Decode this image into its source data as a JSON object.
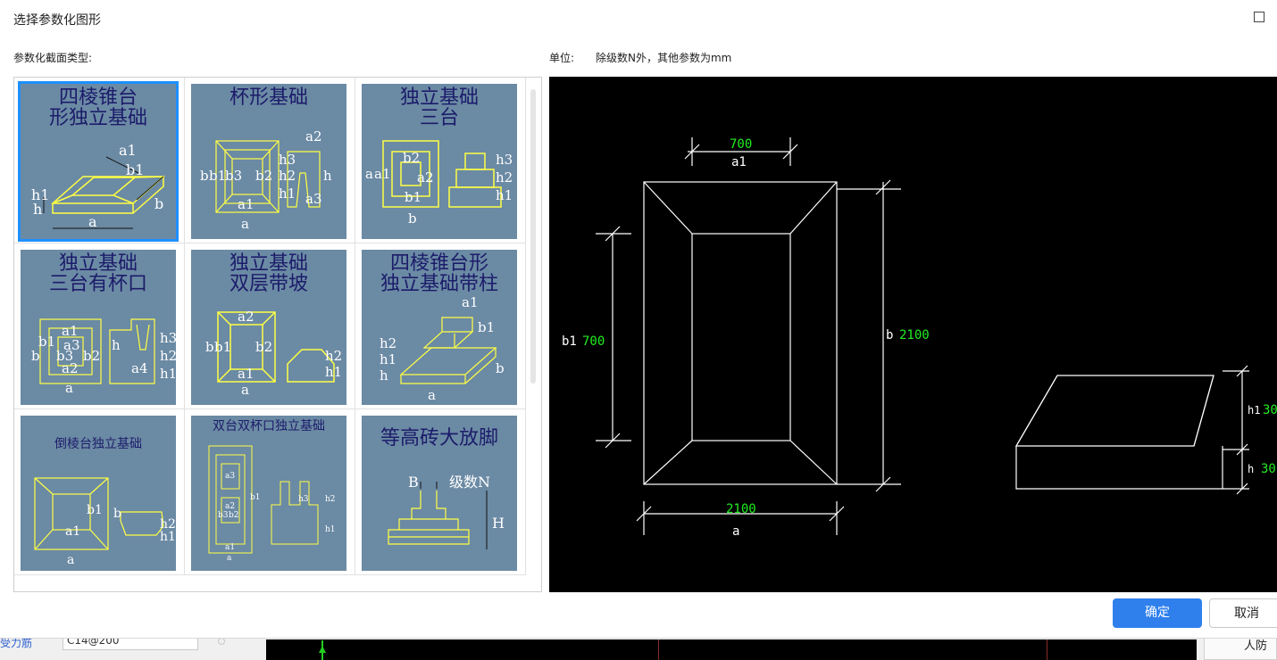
{
  "dialog": {
    "title": "选择参数化图形",
    "section_label": "参数化截面类型:",
    "unit_label": "单位:",
    "unit_text": "除级数N外，其他参数为mm",
    "ok_label": "确定",
    "cancel_label": "取消"
  },
  "gallery": {
    "items": [
      {
        "title": "四棱锥台形独立基础",
        "line1": "四棱锥台",
        "line2": "形独立基础",
        "selected": true
      },
      {
        "title": "杯形基础",
        "line1": "杯形基础",
        "line2": "",
        "selected": false
      },
      {
        "title": "独立基础三台",
        "line1": "独立基础",
        "line2": "三台",
        "selected": false
      },
      {
        "title": "独立基础三台有杯口",
        "line1": "独立基础",
        "line2": "三台有杯口",
        "selected": false
      },
      {
        "title": "独立基础双层带坡",
        "line1": "独立基础",
        "line2": "双层带坡",
        "selected": false
      },
      {
        "title": "四棱锥台形独立基础带柱",
        "line1": "四棱锥台形",
        "line2": "独立基础带柱",
        "selected": false
      },
      {
        "title": "倒棱台独立基础",
        "line1": "倒棱台独立基础",
        "line2": "",
        "selected": false
      },
      {
        "title": "双台双杯口独立基础",
        "line1": "双台双杯口独立基础",
        "line2": "",
        "selected": false
      },
      {
        "title": "等高砖大放脚",
        "line1": "等高砖大放脚",
        "line2": "",
        "selected": false
      }
    ],
    "thumb_labels": {
      "t1": [
        "a1",
        "b1",
        "h1",
        "h",
        "a",
        "b"
      ],
      "t2": [
        "a2",
        "h3",
        "h2",
        "h1",
        "h",
        "a3",
        "b",
        "b1",
        "b3",
        "b2",
        "a1",
        "a"
      ],
      "t3": [
        "a",
        "a1",
        "b2",
        "a2",
        "b1",
        "b",
        "h3",
        "h2",
        "h1"
      ],
      "t4": [
        "a1",
        "a3",
        "b1",
        "b3",
        "b2",
        "b",
        "a2",
        "a",
        "h",
        "a4",
        "h3",
        "h2",
        "h1"
      ],
      "t5": [
        "a2",
        "b",
        "b1",
        "b2",
        "a1",
        "a",
        "h2",
        "h1"
      ],
      "t6": [
        "a1",
        "b1",
        "h2",
        "h1",
        "h",
        "a",
        "b"
      ],
      "t7": [
        "b1",
        "a1",
        "a",
        "b",
        "h2",
        "h1"
      ],
      "t8": [
        "a3",
        "a2",
        "b3",
        "b2",
        "a1",
        "a",
        "b1",
        "h3",
        "h2",
        "h1"
      ],
      "t9": [
        "B",
        "级数N",
        "H"
      ]
    }
  },
  "preview": {
    "plan": {
      "a1_value": "700",
      "a1_name": "a1",
      "b1_value": "700",
      "b1_name": "b1",
      "b_value": "2100",
      "b_name": "b",
      "a_value": "2100",
      "a_name": "a"
    },
    "section": {
      "h1_name": "h1",
      "h1_value": "30",
      "h_name": "h",
      "h_value": "30"
    }
  },
  "background": {
    "field_label": "受力筋",
    "field_value": "C14@200",
    "right_label": "人防"
  },
  "colors": {
    "primary": "#2f80ed",
    "thumb_bg": "#6b8aa4",
    "thumb_lines": "#ffff44",
    "cad_green": "#22ee22"
  }
}
